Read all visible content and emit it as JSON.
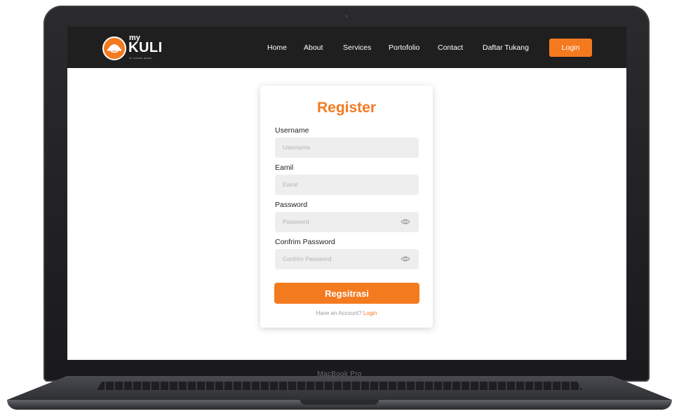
{
  "device": {
    "label": "MacBook Pro"
  },
  "navbar": {
    "logo": {
      "small": "my",
      "brand": "KULI",
      "tagline": "di rumah anda"
    },
    "links": [
      {
        "label": "Home"
      },
      {
        "label": "About"
      },
      {
        "label": "Services"
      },
      {
        "label": "Portofolio"
      },
      {
        "label": "Contact"
      },
      {
        "label": "Daftar Tukang"
      }
    ],
    "login_label": "Login"
  },
  "register": {
    "title": "Register",
    "fields": [
      {
        "label": "Username",
        "placeholder": "Username",
        "icon": null
      },
      {
        "label": "Eamil",
        "placeholder": "Eamil",
        "icon": null
      },
      {
        "label": "Password",
        "placeholder": "Password",
        "icon": "eye-icon"
      },
      {
        "label": "Confrim Password",
        "placeholder": "Confrim Password",
        "icon": "eye-icon"
      }
    ],
    "submit_label": "Regsitrasi",
    "footer_text": "Have an Account?",
    "footer_link": "Login"
  },
  "colors": {
    "accent": "#f47a20",
    "nav_bg": "#1f1f1f",
    "field_bg": "#eeeeee"
  }
}
